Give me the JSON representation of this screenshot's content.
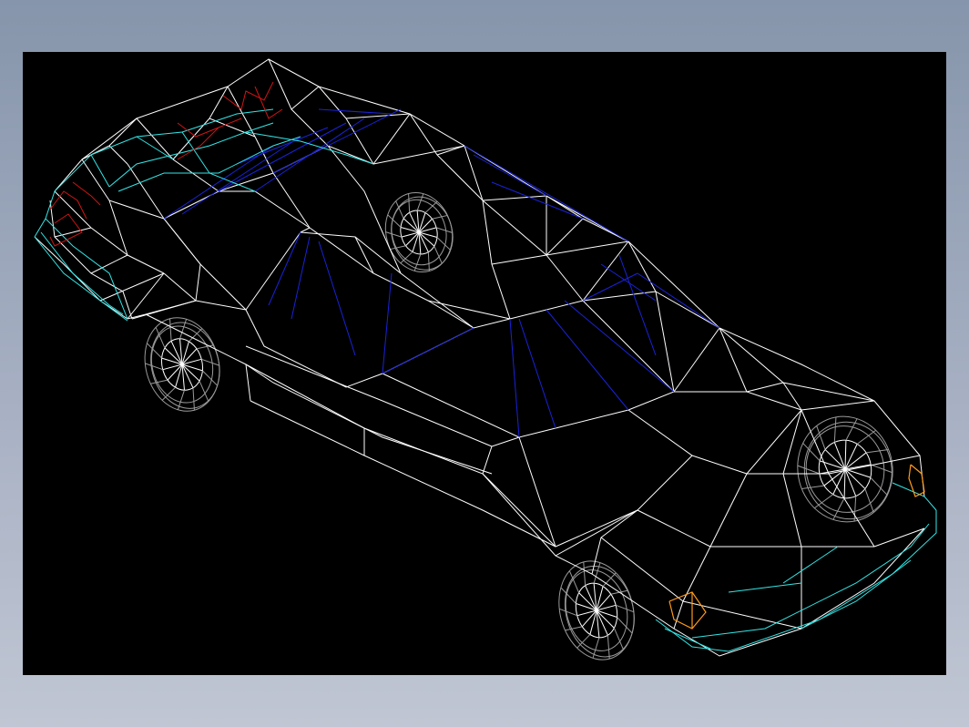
{
  "viewport": {
    "background": "#000000"
  },
  "model": {
    "colors": {
      "body": "#ffffff",
      "trim": "#33e6e6",
      "glass": "#1a22d8",
      "taillight": "#d21414",
      "indicator": "#ff9a1a",
      "wheel": "#9a9a9a"
    }
  }
}
